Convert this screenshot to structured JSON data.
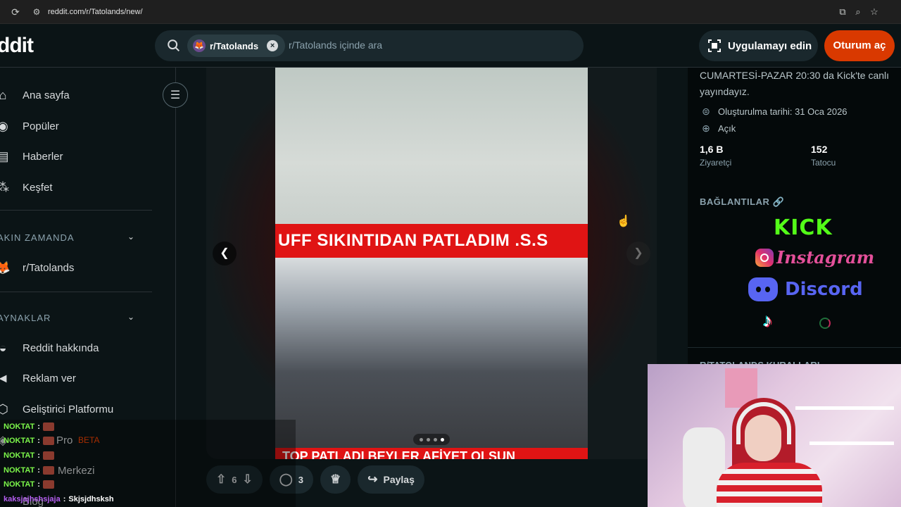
{
  "browser": {
    "url": "reddit.com/r/Tatolands/new/"
  },
  "header": {
    "logo": "ddit",
    "search_chip": "r/Tatolands",
    "search_placeholder": "r/Tatolands içinde ara",
    "app_button": "Uygulamayı edin",
    "login_button": "Oturum aç"
  },
  "sidebar": {
    "main_items": [
      {
        "label": "Ana sayfa",
        "icon": "home-icon"
      },
      {
        "label": "Popüler",
        "icon": "popular-icon"
      },
      {
        "label": "Haberler",
        "icon": "news-icon"
      },
      {
        "label": "Keşfet",
        "icon": "explore-icon"
      }
    ],
    "recent_title": "AKIN ZAMANDA",
    "recent_items": [
      {
        "label": "r/Tatolands"
      }
    ],
    "resources_title": "AYNAKLAR",
    "resource_items": [
      {
        "label": "Reddit hakkında"
      },
      {
        "label": "Reklam ver"
      },
      {
        "label": "Geliştirici Platformu"
      },
      {
        "label": "Pro",
        "badge": "BETA"
      },
      {
        "label": "Merkezi"
      },
      {
        "label": "Blog"
      }
    ]
  },
  "post": {
    "banner_top": "UFF SIKINTIDAN PATLADIM .S.S",
    "banner_bottom": "TOP PATLADI BEYLER AFİYET OLSUN",
    "carousel_pages": 4,
    "carousel_active": 4,
    "votes": "6",
    "comments": "3",
    "share_label": "Paylaş"
  },
  "right_panel": {
    "description": "CUMARTESİ-PAZAR 20:30 da Kick'te canlı yayındayız.",
    "created": "Oluşturulma tarihi: 31 Oca 2026",
    "visibility": "Açık",
    "stats": [
      {
        "value": "1,6 B",
        "label": "Ziyaretçi"
      },
      {
        "value": "152",
        "label": "Tatocu"
      }
    ],
    "links_title": "BAĞLANTILAR 🔗",
    "links": {
      "kick": "KICK",
      "instagram": "Instagram",
      "discord": "Discord"
    },
    "rules_title": "R/TATOLANDS KURALLARI"
  },
  "chat": {
    "lines": [
      {
        "user": "NOKTAT",
        "msg": ""
      },
      {
        "user": "NOKTAT",
        "msg": ""
      },
      {
        "user": "NOKTAT",
        "msg": ""
      },
      {
        "user": "NOKTAT",
        "msg": ""
      },
      {
        "user": "NOKTAT",
        "msg": ""
      },
      {
        "user": "kaksjajhshsjaja",
        "msg": "Skjsjdhsksh"
      }
    ]
  },
  "colors": {
    "accent": "#d93900",
    "background": "#0b1416",
    "banner_red": "#e01414",
    "kick_green": "#53fc18",
    "discord_blue": "#5865f2"
  }
}
